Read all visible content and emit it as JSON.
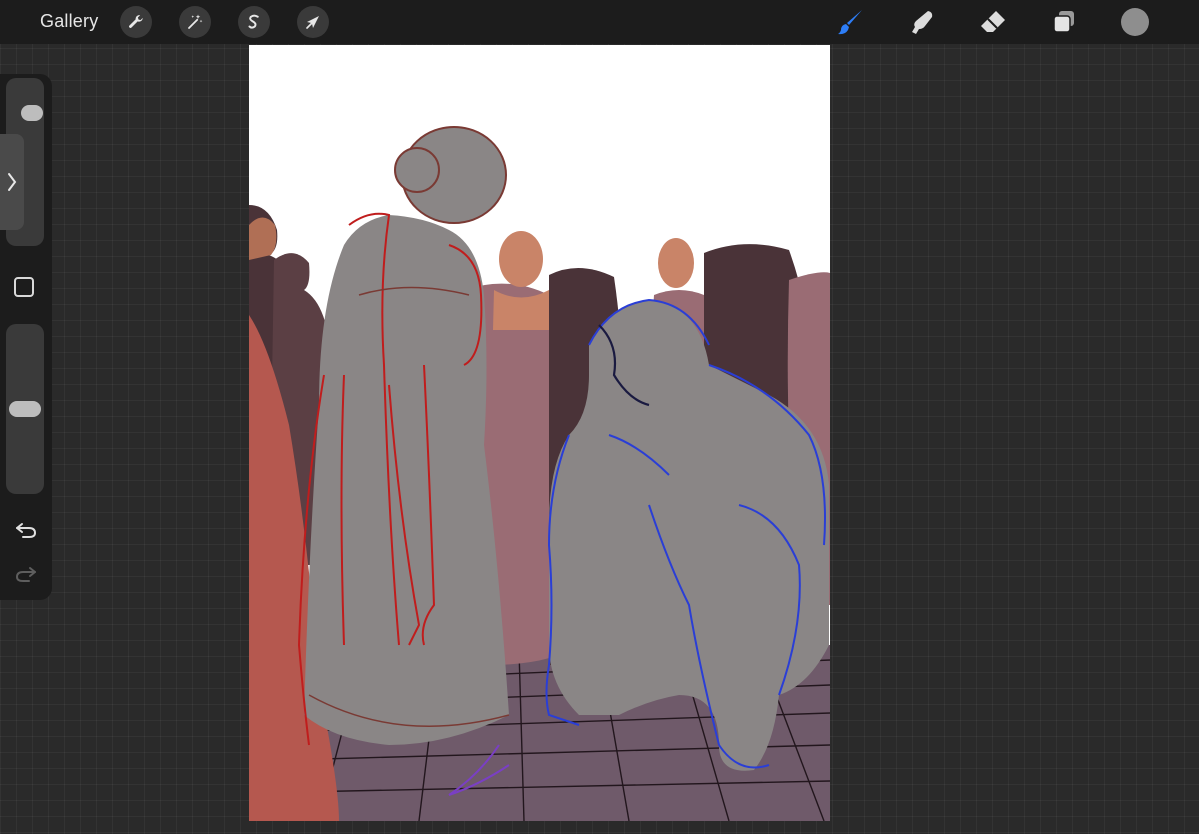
{
  "topbar": {
    "gallery_label": "Gallery",
    "left_tools": [
      {
        "name": "actions",
        "icon": "wrench-icon"
      },
      {
        "name": "adjustments",
        "icon": "magic-wand-icon"
      },
      {
        "name": "selection",
        "icon": "selection-s-icon"
      },
      {
        "name": "transform",
        "icon": "arrow-cursor-icon"
      }
    ],
    "right_tools": [
      {
        "name": "brush",
        "icon": "brush-icon",
        "active": true
      },
      {
        "name": "smudge",
        "icon": "smudge-finger-icon",
        "active": false
      },
      {
        "name": "eraser",
        "icon": "eraser-icon",
        "active": false
      },
      {
        "name": "layers",
        "icon": "layers-icon",
        "active": false
      }
    ],
    "active_color": "#8e8e8e",
    "accent_color": "#2d7df6"
  },
  "sidebar": {
    "brush_size_level": 0.82,
    "opacity_level": 0.5,
    "icons": [
      "chevron-right-icon",
      "modify-square-icon",
      "undo-icon",
      "redo-icon"
    ]
  }
}
